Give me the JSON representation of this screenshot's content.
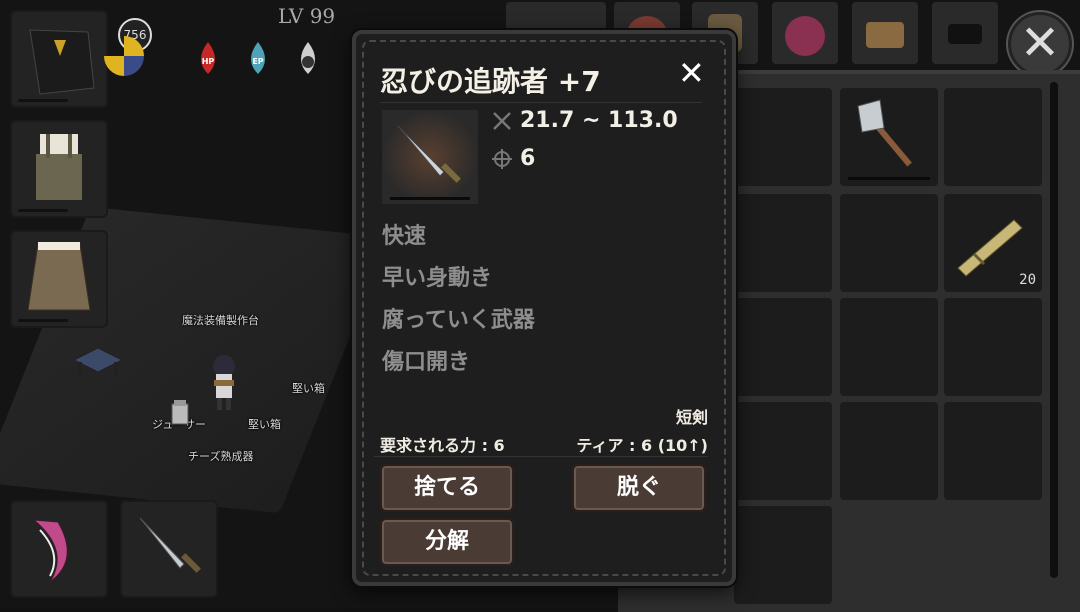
{
  "hud": {
    "level": "LV 99",
    "badge": "756",
    "orbs": [
      {
        "label": "HP",
        "color": "#c62828"
      },
      {
        "label": "EP",
        "color": "#4fa3b8"
      },
      {
        "label": "",
        "color": "#cfcfcf"
      }
    ]
  },
  "world": {
    "labels": [
      "魔法装備製作台",
      "堅い箱",
      "ジューサー",
      "堅い箱",
      "チーズ熟成器"
    ]
  },
  "tooltip": {
    "title": "忍びの追跡者 +7",
    "close": "✕",
    "damage": "21.7 ~ 113.0",
    "accuracy": "6",
    "traits": [
      "快速",
      "早い身動き",
      "腐っていく武器",
      "傷口開き"
    ],
    "type": "短剣",
    "requirement": "要求される力 : 6",
    "tier": "ティア : 6 (10↑)",
    "buttons": {
      "discard": "捨てる",
      "unequip": "脱ぐ",
      "disassemble": "分解"
    }
  },
  "inventory": {
    "grass_count": "20"
  },
  "close_button": "✕",
  "colors": {
    "panel": "#1e1e1e",
    "button": "#4a3b34",
    "trait_text": "#8e8e8e"
  }
}
